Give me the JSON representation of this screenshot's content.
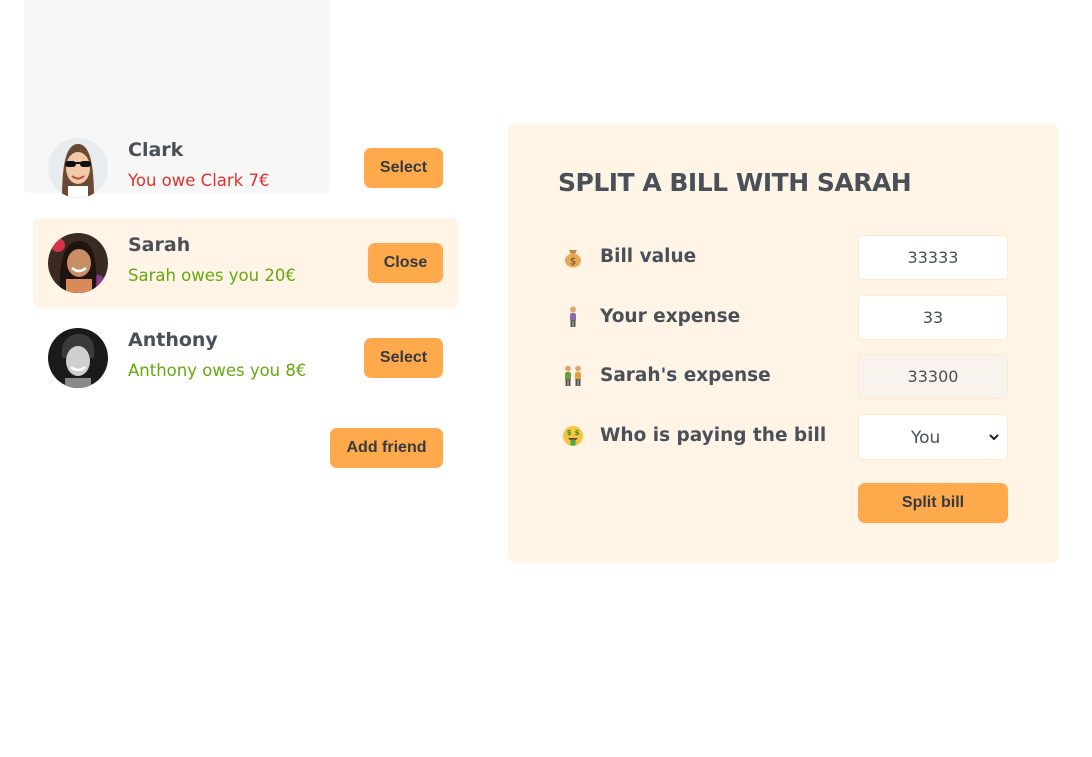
{
  "friends": [
    {
      "name": "Clark",
      "balance": "You owe Clark 7€",
      "button": "Select"
    },
    {
      "name": "Sarah",
      "balance": "Sarah owes you 20€",
      "button": "Close"
    },
    {
      "name": "Anthony",
      "balance": "Anthony owes you 8€",
      "button": "Select"
    }
  ],
  "add_friend_label": "Add friend",
  "split": {
    "title": "SPLIT A BILL WITH SARAH",
    "bill_value_label": "Bill value",
    "bill_value": "33333",
    "your_expense_label": "Your expense",
    "your_expense": "33",
    "friend_expense_label": "Sarah's expense",
    "friend_expense": "33300",
    "payer_label": "Who is paying the bill",
    "payer_value": "You",
    "submit_label": "Split bill"
  },
  "colors": {
    "accent": "#ffa94d",
    "panel": "#fff4e6",
    "owe": "#e03131",
    "owed": "#66a80f"
  }
}
